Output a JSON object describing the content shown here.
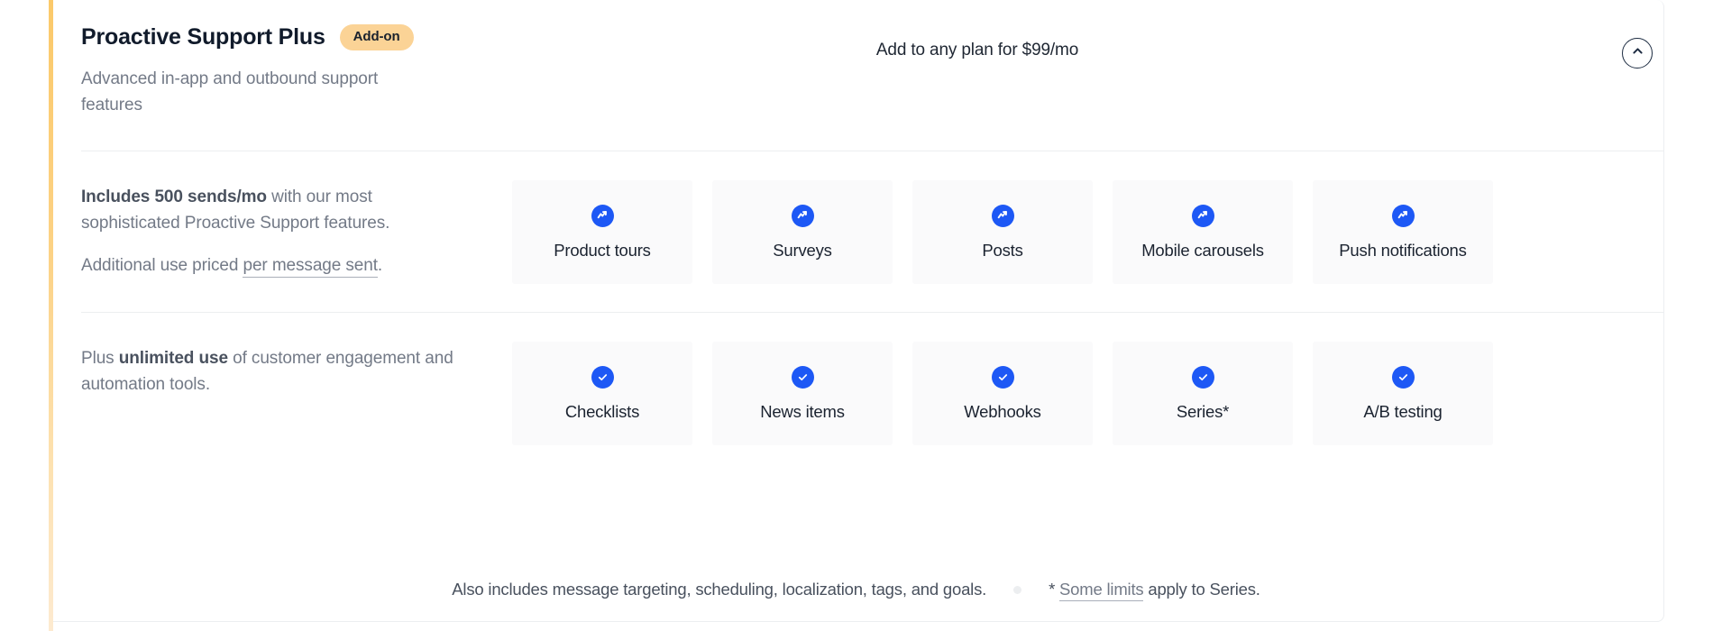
{
  "addon": {
    "title": "Proactive Support Plus",
    "badge": "Add-on",
    "subtitle": "Advanced in-app and outbound support features",
    "price_note": "Add to any plan for $99/mo",
    "collapse_icon": "chevron-up-icon",
    "accent_color": "#fbc96a",
    "badge_color": "#fbd396",
    "icon_color": "#1d58f5"
  },
  "sections": [
    {
      "desc_lead": "Includes 500 sends/mo",
      "desc_rest": " with our most sophisticated Proactive Support features.",
      "desc_second_prefix": "Additional use priced ",
      "desc_second_link": "per message sent",
      "desc_second_suffix": ".",
      "icon": "trend-up-icon",
      "cards": [
        {
          "label": "Product tours",
          "icon": "trend-up-icon"
        },
        {
          "label": "Surveys",
          "icon": "trend-up-icon"
        },
        {
          "label": "Posts",
          "icon": "trend-up-icon"
        },
        {
          "label": "Mobile carousels",
          "icon": "trend-up-icon"
        },
        {
          "label": "Push notifications",
          "icon": "trend-up-icon"
        }
      ]
    },
    {
      "desc_lead_prefix": "Plus ",
      "desc_lead": "unlimited use",
      "desc_rest": " of customer engagement and automation tools.",
      "icon": "check-circle-icon",
      "cards": [
        {
          "label": "Checklists",
          "icon": "check-circle-icon"
        },
        {
          "label": "News items",
          "icon": "check-circle-icon"
        },
        {
          "label": "Webhooks",
          "icon": "check-circle-icon"
        },
        {
          "label": "Series*",
          "icon": "check-circle-icon"
        },
        {
          "label": "A/B testing",
          "icon": "check-circle-icon"
        }
      ]
    }
  ],
  "footer": {
    "left": "Also includes message targeting, scheduling, localization, tags, and goals.",
    "star": "* ",
    "right_link": "Some limits",
    "right_rest": " apply to Series."
  }
}
